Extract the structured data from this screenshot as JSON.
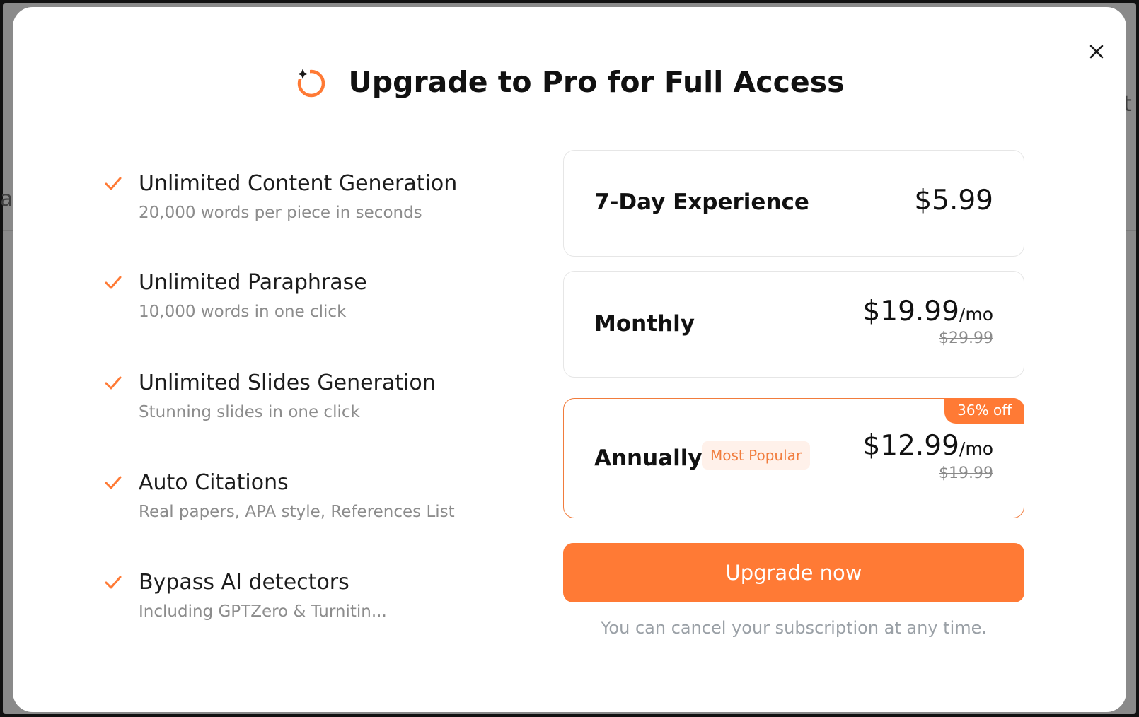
{
  "header": {
    "title": "Upgrade to Pro for Full Access",
    "logo_icon": "ring-sparkle-icon",
    "close_icon": "close-icon"
  },
  "features": [
    {
      "title": "Unlimited Content Generation",
      "subtitle": "20,000 words per piece in seconds",
      "icon": "check-icon"
    },
    {
      "title": "Unlimited Paraphrase",
      "subtitle": "10,000 words in one click",
      "icon": "check-icon"
    },
    {
      "title": "Unlimited Slides Generation",
      "subtitle": "Stunning slides in one click",
      "icon": "check-icon"
    },
    {
      "title": "Auto Citations",
      "subtitle": "Real papers, APA style, References List",
      "icon": "check-icon"
    },
    {
      "title": "Bypass AI detectors",
      "subtitle": "Including GPTZero & Turnitin...",
      "icon": "check-icon"
    }
  ],
  "plans": [
    {
      "name": "7-Day Experience",
      "price": "$5.99"
    },
    {
      "name": "Monthly",
      "price": "$19.99",
      "unit": "/mo",
      "old_price": "$29.99"
    },
    {
      "name": "Annually",
      "badge": "Most Popular",
      "discount": "36% off",
      "price": "$12.99",
      "unit": "/mo",
      "old_price": "$19.99",
      "selected": true
    }
  ],
  "cta": {
    "label": "Upgrade now",
    "note": "You can cancel your subscription at any time."
  },
  "colors": {
    "accent": "#ff7a35",
    "accent_border": "#f17c3d",
    "badge_bg": "#fff1ea",
    "muted_text": "#8c8c8c"
  }
}
